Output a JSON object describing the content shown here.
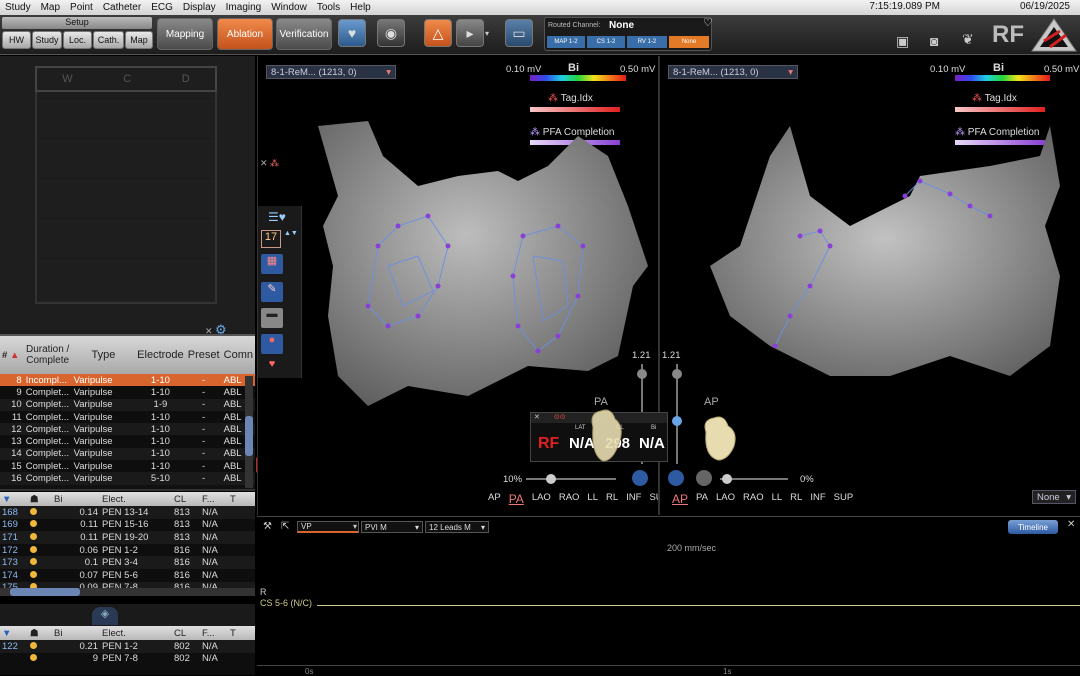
{
  "menu": {
    "items": [
      "Study",
      "Map",
      "Point",
      "Catheter",
      "ECG",
      "Display",
      "Imaging",
      "Window",
      "Tools",
      "Help"
    ],
    "time": "7:15:19.089 PM",
    "date": "06/19/2025"
  },
  "toolbar": {
    "setup_label": "Setup",
    "setup_tabs": [
      "HW",
      "Study",
      "Loc.",
      "Cath.",
      "Map"
    ],
    "mapping_label": "Mapping",
    "ablation_label": "Ablation",
    "verification_label": "Verification",
    "routed_channel_label": "Routed Channel:",
    "routed_channel_value": "None",
    "channel_buttons": [
      "MAP 1-2",
      "CS 1-2",
      "RV 1-2",
      "None"
    ],
    "brand": "RF"
  },
  "left_top": {
    "grid_letters": [
      "W",
      "C",
      "D"
    ]
  },
  "ablation_table": {
    "headers": [
      "#",
      "Duration / Complete",
      "Type",
      "Electrode",
      "Preset",
      "Comn"
    ],
    "rows": [
      {
        "num": "8",
        "status": "Incompl...",
        "type": "Varipulse",
        "elec": "1-10",
        "preset": "-",
        "comn": "ABL",
        "selected": true
      },
      {
        "num": "9",
        "status": "Complet...",
        "type": "Varipulse",
        "elec": "1-10",
        "preset": "-",
        "comn": "ABL"
      },
      {
        "num": "10",
        "status": "Complet...",
        "type": "Varipulse",
        "elec": "1-9",
        "preset": "-",
        "comn": "ABL"
      },
      {
        "num": "11",
        "status": "Complet...",
        "type": "Varipulse",
        "elec": "1-10",
        "preset": "-",
        "comn": "ABL"
      },
      {
        "num": "12",
        "status": "Complet...",
        "type": "Varipulse",
        "elec": "1-10",
        "preset": "-",
        "comn": "ABL"
      },
      {
        "num": "13",
        "status": "Complet...",
        "type": "Varipulse",
        "elec": "1-10",
        "preset": "-",
        "comn": "ABL"
      },
      {
        "num": "14",
        "status": "Complet...",
        "type": "Varipulse",
        "elec": "1-10",
        "preset": "-",
        "comn": "ABL"
      },
      {
        "num": "15",
        "status": "Complet...",
        "type": "Varipulse",
        "elec": "1-10",
        "preset": "-",
        "comn": "ABL"
      },
      {
        "num": "16",
        "status": "Complet...",
        "type": "Varipulse",
        "elec": "5-10",
        "preset": "-",
        "comn": "ABL"
      }
    ]
  },
  "points_table": {
    "headers": [
      "",
      "",
      "Bi",
      "Elect.",
      "CL",
      "F...",
      "T"
    ],
    "rows": [
      {
        "num": "168",
        "bi": "0.14",
        "elect": "PEN 13-14",
        "cl": "813",
        "f": "N/A"
      },
      {
        "num": "169",
        "bi": "0.11",
        "elect": "PEN 15-16",
        "cl": "813",
        "f": "N/A"
      },
      {
        "num": "171",
        "bi": "0.11",
        "elect": "PEN 19-20",
        "cl": "813",
        "f": "N/A"
      },
      {
        "num": "172",
        "bi": "0.06",
        "elect": "PEN 1-2",
        "cl": "816",
        "f": "N/A"
      },
      {
        "num": "173",
        "bi": "0.1",
        "elect": "PEN 3-4",
        "cl": "816",
        "f": "N/A"
      },
      {
        "num": "174",
        "bi": "0.07",
        "elect": "PEN 5-6",
        "cl": "816",
        "f": "N/A"
      },
      {
        "num": "175",
        "bi": "0.09",
        "elect": "PEN 7-8",
        "cl": "816",
        "f": "N/A"
      }
    ]
  },
  "points_table2": {
    "headers": [
      "",
      "",
      "Bi",
      "Elect.",
      "CL",
      "F...",
      "T"
    ],
    "rows": [
      {
        "num": "122",
        "bi": "0.21",
        "elect": "PEN 1-2",
        "cl": "802",
        "f": "N/A"
      },
      {
        "num": "",
        "bi": "9",
        "elect": "PEN 7-8",
        "cl": "802",
        "f": "N/A"
      }
    ]
  },
  "left_map": {
    "map_name": "8-1-ReM... (1213, 0)",
    "scale_min": "0.10 mV",
    "scale_label": "Bi",
    "scale_max": "0.50 mV",
    "tag_label": "Tag.Idx",
    "pfa_label": "PFA Completion",
    "level_value": "17",
    "slider_value": "1.21",
    "orientation": "PA",
    "zoom": "10%",
    "views": [
      "AP",
      "PA",
      "LAO",
      "RAO",
      "LL",
      "RL",
      "INF",
      "SUP"
    ],
    "active_view": "PA"
  },
  "right_map": {
    "map_name": "8-1-ReM... (1213, 0)",
    "scale_min": "0.10 mV",
    "scale_label": "Bi",
    "scale_max": "0.50 mV",
    "tag_label": "Tag.Idx",
    "pfa_label": "PFA Completion",
    "slider_value": "1.21",
    "orientation": "AP",
    "zoom": "0%",
    "views": [
      "AP",
      "PA",
      "LAO",
      "RAO",
      "LL",
      "RL",
      "INF",
      "SUP"
    ],
    "active_view": "AP",
    "none_dropdown": "None"
  },
  "status": {
    "rf_label": "RF",
    "lat_label": "LAT",
    "cl_label": "CL",
    "bi_label": "Bi",
    "lat_value": "N/A",
    "cl_value": "298",
    "bi_value": "N/A"
  },
  "ecg": {
    "vp_label": "VP",
    "pvi_label": "PVI M",
    "leads_label": "12 Leads M",
    "timeline_label": "Timeline",
    "speed": "200 mm/sec",
    "r_label": "R",
    "channel_label": "CS 5-6 (N/C)",
    "time_start": "0s",
    "time_mark": "1s"
  },
  "colors": {
    "accent_orange": "#d8652d",
    "channel_yellow": "#cfc98a",
    "map_purple": "#8a3fd6"
  }
}
